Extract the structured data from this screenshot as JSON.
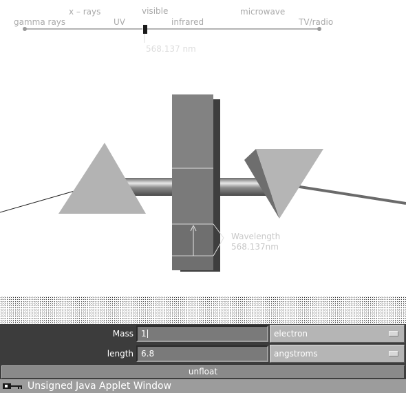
{
  "spectrum": {
    "top_labels": [
      "x – rays",
      "visible",
      "microwave"
    ],
    "bottom_labels": [
      "gamma rays",
      "UV",
      "infrared",
      "TV/radio"
    ],
    "marker_value": "568.137 nm"
  },
  "scene": {
    "wavelength_title": "Wavelength",
    "wavelength_value": "568.137nm"
  },
  "controls": {
    "mass_label": "Mass",
    "mass_value": "1",
    "mass_unit": "electron",
    "length_label": "length",
    "length_value": "6.8",
    "length_unit": "angstroms",
    "unfloat_label": "unfloat"
  },
  "status": {
    "text": "Unsigned Java Applet Window"
  },
  "colors": {
    "background": "#ffffff",
    "panel": "#3c3c3c",
    "faint_text": "#a9a9a9"
  }
}
